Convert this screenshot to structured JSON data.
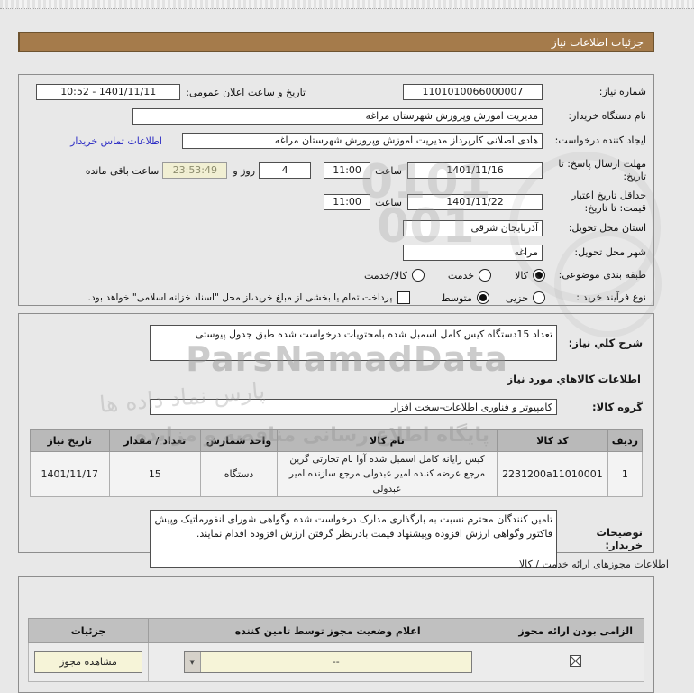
{
  "page": {
    "title_bar": "جزئیات اطلاعات نیاز"
  },
  "colors": {
    "accent_brown": "#a57b4b",
    "cream": "#f6f4d8",
    "link_blue": "#2b2bc4",
    "header_gray": "#b9b9b9"
  },
  "watermarks": {
    "brand": "ParsNamadData",
    "digits_line1": "0101",
    "digits_line2": "001",
    "persian_line1": "پارس نماد داده ها",
    "persian_line2": "پایگاه اطلاع رسانی مناقصه و مزایده"
  },
  "need_info": {
    "need_number_label": "شماره نیاز:",
    "need_number": "1101010066000007",
    "publish_datetime_label": "تاریخ و ساعت اعلان عمومی:",
    "publish_datetime": "1401/11/11 - 10:52",
    "buyer_org_label": "نام دستگاه خریدار:",
    "buyer_org": "مدیریت اموزش وپرورش شهرستان مراغه",
    "request_creator_label": "ایجاد کننده درخواست:",
    "request_creator": "هادی اصلانی کارپرداز مدیریت اموزش وپرورش شهرستان مراغه",
    "buyer_contact_link": "اطلاعات تماس خریدار",
    "reply_deadline_label": "مهلت ارسال پاسخ: تا تاریخ:",
    "reply_deadline_date": "1401/11/16",
    "hour_label": "ساعت",
    "reply_deadline_time": "11:00",
    "days_remaining": "4",
    "days_and_label": "روز و",
    "countdown": "23:53:49",
    "remaining_label": "ساعت باقی مانده",
    "price_validity_label": "حداقل تاریخ اعتبار قیمت: تا تاریخ:",
    "price_validity_date": "1401/11/22",
    "price_validity_time": "11:00",
    "province_label": "استان محل تحویل:",
    "province": "آذربایجان شرقی",
    "city_label": "شهر محل تحویل:",
    "city": "مراغه",
    "subject_classification": {
      "label": "طبقه بندی موضوعی:",
      "options": [
        {
          "label": "کالا",
          "selected": true
        },
        {
          "label": "خدمت",
          "selected": false
        },
        {
          "label": "کالا/خدمت",
          "selected": false
        }
      ]
    },
    "process_type": {
      "label": "نوع فرآیند خرید :",
      "options": [
        {
          "label": "جزیی",
          "selected": false
        },
        {
          "label": "متوسط",
          "selected": true
        }
      ],
      "treasury_checked": false,
      "treasury_text": "پرداخت تمام یا بخشی از مبلغ خرید،از محل \"اسناد خزانه اسلامی\" خواهد بود."
    }
  },
  "need_desc": {
    "label": "شرح کلي نیاز:",
    "value": "تعداد 15دستگاه کیس کامل اسمبل شده بامحتویات درخواست شده طبق جدول پیوستی",
    "goods_info_heading": "اطلاعات کالاهاي مورد نیاز",
    "goods_group_label": "گروه کالا:",
    "goods_group": "کامپیوتر و فناوری اطلاعات-سخت افزار"
  },
  "goods_table": {
    "headers": {
      "row_no": "ردیف",
      "code": "کد کالا",
      "name": "نام کالا",
      "unit": "واحد شمارش",
      "qty": "تعداد / مقدار",
      "need_date": "تاریخ نیاز"
    },
    "row": {
      "row_no": "1",
      "code": "2231200a11010001",
      "name": "کیس رایانه کامل اسمبل شده آوا نام تجارتی گرین مرجع عرضه کننده امیر عبدولی مرجع سازنده امیر عبدولی",
      "unit": "دستگاه",
      "qty": "15",
      "need_date": "1401/11/17"
    }
  },
  "buyer_notes": {
    "label": "توضیحات خریدار:",
    "value": "تامین کنندگان محترم نسبت به بارگذاری مدارک درخواست شده وگواهی شورای انفورماتیک وپیش فاکتور وگواهی ارزش افزوده وپیشنهاد قیمت بادرنظر گرفتن ارزش افزوده اقدام نمایند."
  },
  "license_section": {
    "heading": "اطلاعات مجوزهای ارائه خدمت / کالا",
    "headers": {
      "required": "الزامی بودن ارائه مجوز",
      "status": "اعلام وضعیت مجوز توسط تامین کننده",
      "details": "جزئیات"
    },
    "required_checked": true,
    "status_value": "--",
    "details_button": "مشاهده مجوز"
  }
}
